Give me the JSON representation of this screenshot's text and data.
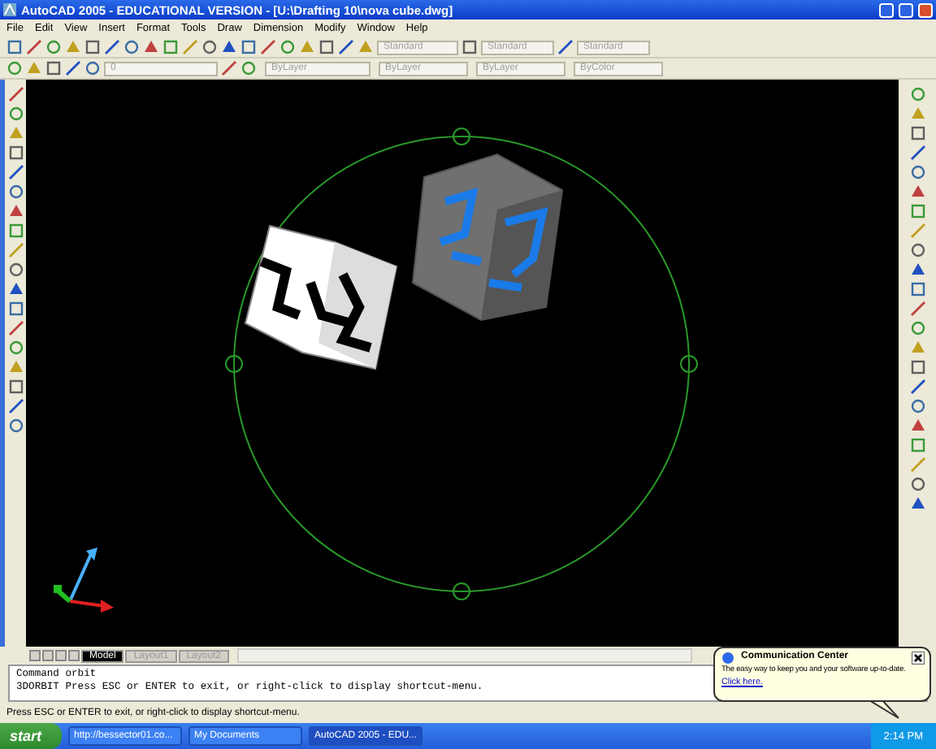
{
  "window": {
    "title": "AutoCAD 2005 - EDUCATIONAL VERSION - [U:\\Drafting 10\\nova cube.dwg]"
  },
  "menu": [
    "File",
    "Edit",
    "View",
    "Insert",
    "Format",
    "Tools",
    "Draw",
    "Dimension",
    "Modify",
    "Window",
    "Help"
  ],
  "styles_toolbar": [
    "Standard",
    "Standard",
    "Standard"
  ],
  "layer": "0",
  "properties_toolbar": [
    "ByLayer",
    "ByLayer",
    "ByLayer",
    "ByColor"
  ],
  "layout_tabs": [
    {
      "label": "Model",
      "selected": true
    },
    {
      "label": "Layout1",
      "selected": false
    },
    {
      "label": "Layout2",
      "selected": false
    }
  ],
  "command_lines": [
    "Command  orbit",
    "3DORBIT Press ESC or ENTER to exit, or right-click to display shortcut-menu."
  ],
  "status_bar": "Press ESC or ENTER to exit, or right-click to display shortcut-menu.",
  "balloon": {
    "title": "Communication Center",
    "text": "The easy way to keep you and your software up-to-date.",
    "link": "Click here."
  },
  "taskbar": {
    "start": "start",
    "tasks": [
      {
        "label": "http://bessector01.co...",
        "selected": false
      },
      {
        "label": "My Documents",
        "selected": false
      },
      {
        "label": "AutoCAD 2005 - EDU...",
        "selected": true
      }
    ],
    "clock": "2:14 PM"
  }
}
